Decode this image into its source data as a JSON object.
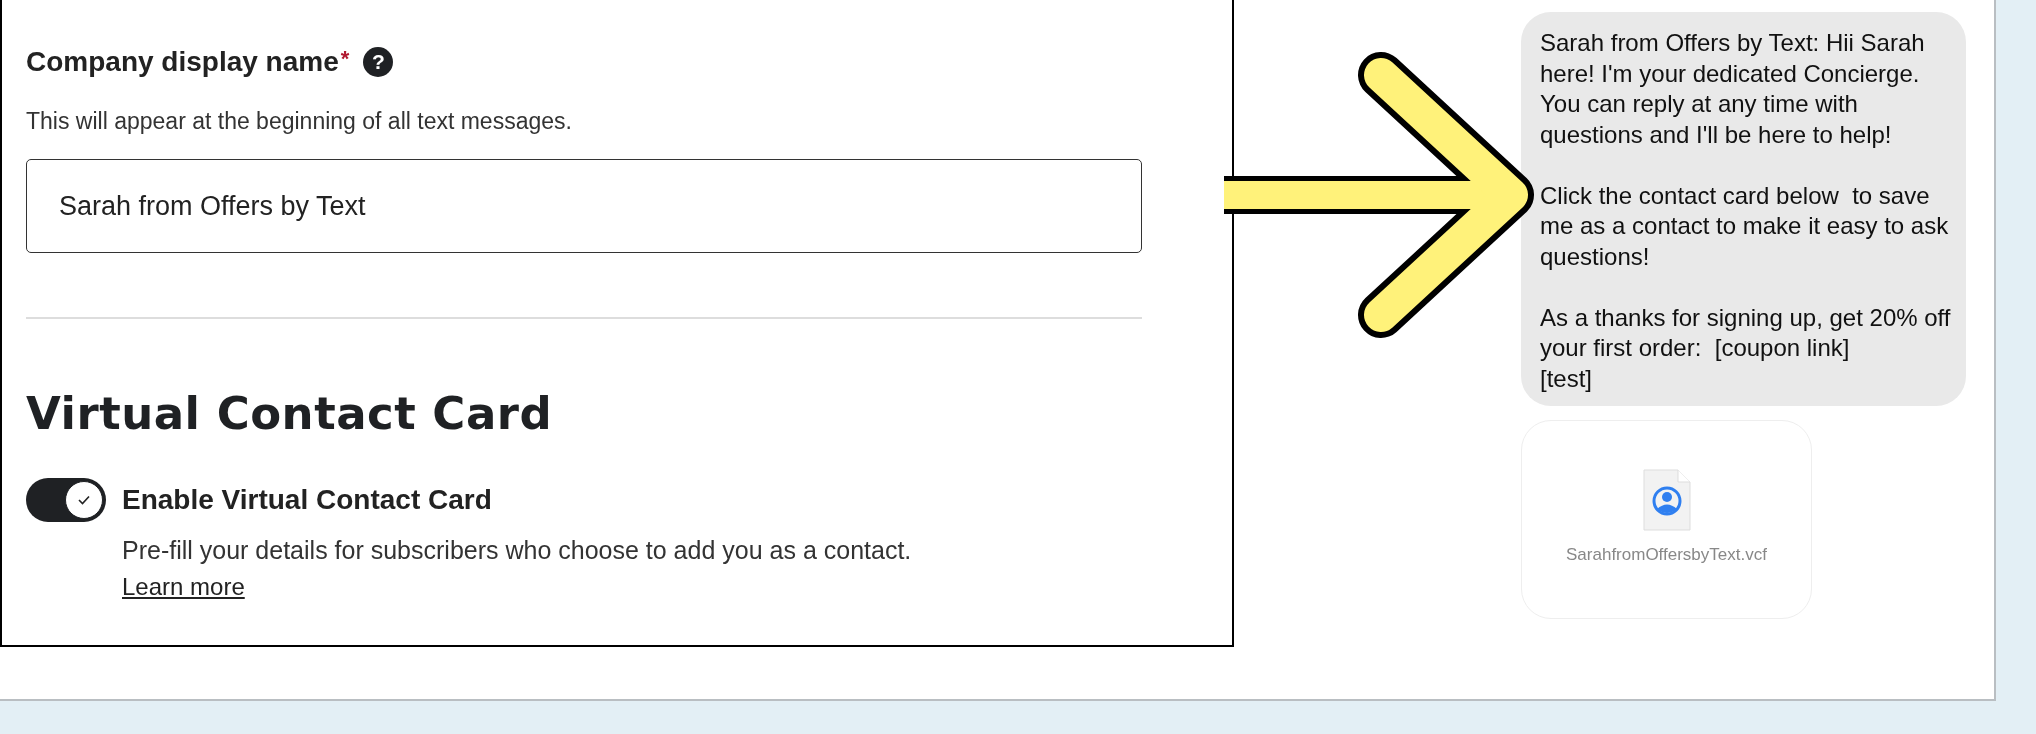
{
  "company_name_field": {
    "label": "Company display name",
    "required_mark": "*",
    "help_icon": "?",
    "description": "This will appear at the beginning of all text messages.",
    "value": "Sarah from Offers by Text"
  },
  "virtual_contact_card": {
    "heading": "Virtual Contact Card",
    "toggle": {
      "label": "Enable Virtual Contact Card",
      "on": true
    },
    "description": "Pre-fill your details for subscribers who choose to add you as a contact.",
    "link": "Learn more"
  },
  "preview": {
    "message": "Sarah from Offers by Text: Hii Sarah here! I'm your dedicated Concierge. You can reply at any time with questions and I'll be here to help!\n\nClick the contact card below  to save me as a contact to make it easy to ask questions!\n\nAs a thanks for signing up, get 20% off your first order:  [coupon link]\n[test]",
    "attachment": {
      "filename": "SarahfromOffersbyText.vcf"
    }
  }
}
